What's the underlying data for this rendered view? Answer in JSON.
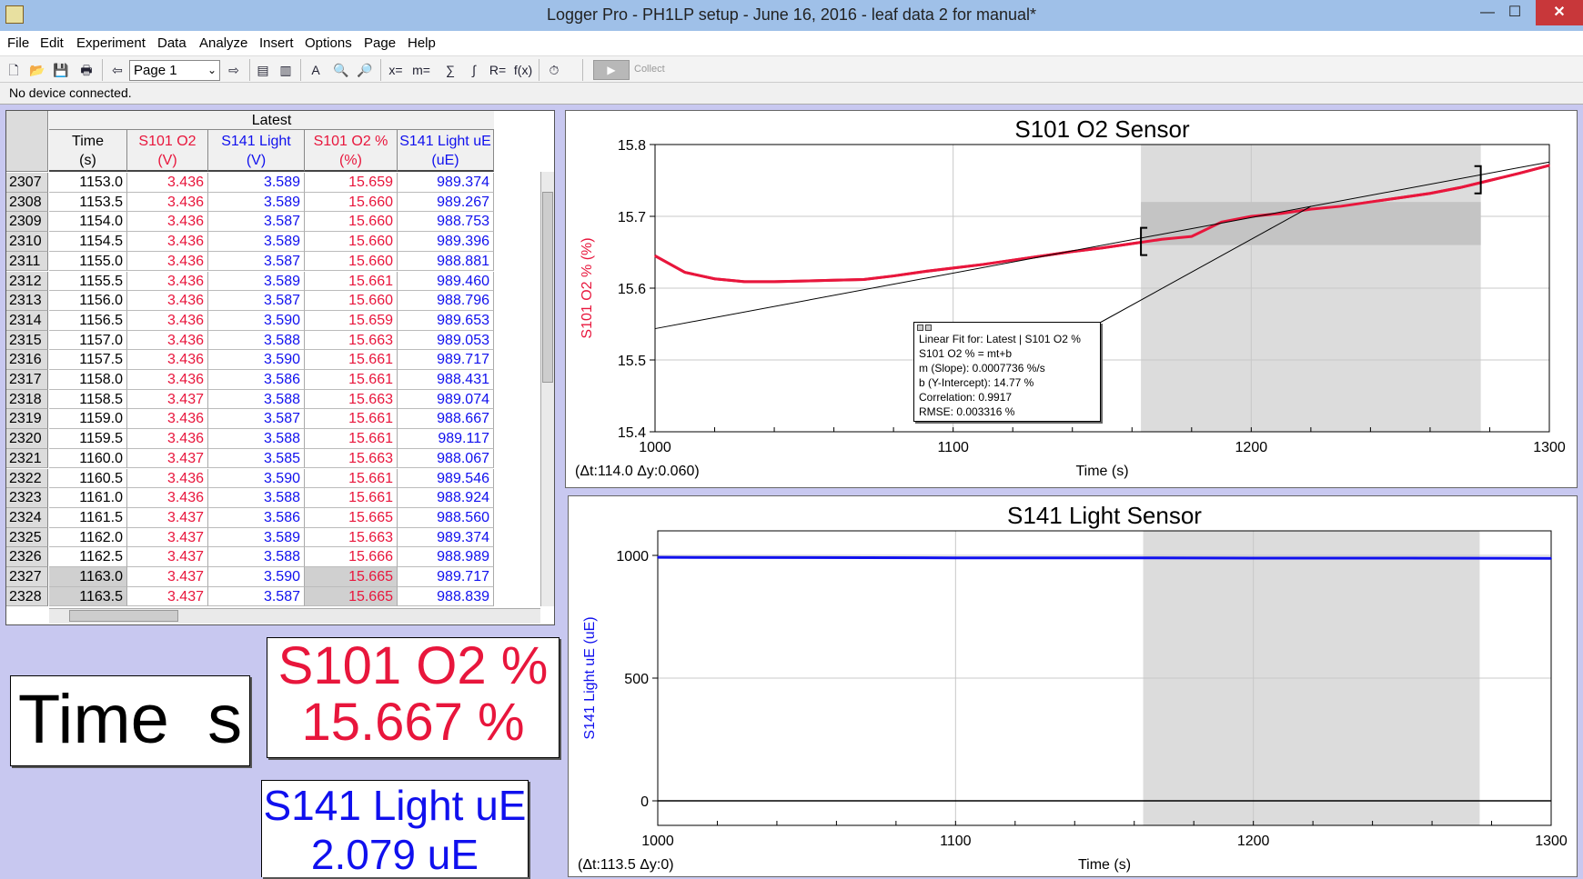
{
  "window": {
    "title": "Logger Pro - PH1LP setup  - June 16, 2016 - leaf data 2 for manual*",
    "minimize": "—",
    "maximize": "☐",
    "close": "✕"
  },
  "menu": [
    "File",
    "Edit",
    "Experiment",
    "Data",
    "Analyze",
    "Insert",
    "Options",
    "Page",
    "Help"
  ],
  "toolbar": {
    "page_select": "Page 1",
    "collect_label": "Collect",
    "icons": [
      "new-file-icon",
      "open-folder-icon",
      "save-icon",
      "print-icon",
      "page-back-icon",
      "page-forward-icon",
      "data-browser-icon",
      "lab-book-icon",
      "autoscale-icon",
      "zoom-in-icon",
      "zoom-out-icon",
      "examine-icon",
      "tangent-icon",
      "statistics-icon",
      "integral-icon",
      "linear-fit-icon",
      "curve-fit-icon",
      "replay-icon",
      "collect-icon"
    ]
  },
  "status": "No device connected.",
  "table": {
    "group": "Latest",
    "columns": [
      {
        "name": "Time",
        "unit": "(s)",
        "color": "#000000"
      },
      {
        "name": "S101 O2",
        "unit": "(V)",
        "color": "#e8163c"
      },
      {
        "name": "S141 Light",
        "unit": "(V)",
        "color": "#1010ee"
      },
      {
        "name": "S101 O2 %",
        "unit": "(%)",
        "color": "#e8163c"
      },
      {
        "name": "S141 Light uE",
        "unit": "(uE)",
        "color": "#1010ee"
      }
    ],
    "rows": [
      [
        "2307",
        "1153.0",
        "3.436",
        "3.589",
        "15.659",
        "989.374"
      ],
      [
        "2308",
        "1153.5",
        "3.436",
        "3.589",
        "15.660",
        "989.267"
      ],
      [
        "2309",
        "1154.0",
        "3.436",
        "3.587",
        "15.660",
        "988.753"
      ],
      [
        "2310",
        "1154.5",
        "3.436",
        "3.589",
        "15.660",
        "989.396"
      ],
      [
        "2311",
        "1155.0",
        "3.436",
        "3.587",
        "15.660",
        "988.881"
      ],
      [
        "2312",
        "1155.5",
        "3.436",
        "3.589",
        "15.661",
        "989.460"
      ],
      [
        "2313",
        "1156.0",
        "3.436",
        "3.587",
        "15.660",
        "988.796"
      ],
      [
        "2314",
        "1156.5",
        "3.436",
        "3.590",
        "15.659",
        "989.653"
      ],
      [
        "2315",
        "1157.0",
        "3.436",
        "3.588",
        "15.663",
        "989.053"
      ],
      [
        "2316",
        "1157.5",
        "3.436",
        "3.590",
        "15.661",
        "989.717"
      ],
      [
        "2317",
        "1158.0",
        "3.436",
        "3.586",
        "15.661",
        "988.431"
      ],
      [
        "2318",
        "1158.5",
        "3.437",
        "3.588",
        "15.663",
        "989.074"
      ],
      [
        "2319",
        "1159.0",
        "3.436",
        "3.587",
        "15.661",
        "988.667"
      ],
      [
        "2320",
        "1159.5",
        "3.436",
        "3.588",
        "15.661",
        "989.117"
      ],
      [
        "2321",
        "1160.0",
        "3.437",
        "3.585",
        "15.663",
        "988.067"
      ],
      [
        "2322",
        "1160.5",
        "3.436",
        "3.590",
        "15.661",
        "989.546"
      ],
      [
        "2323",
        "1161.0",
        "3.436",
        "3.588",
        "15.661",
        "988.924"
      ],
      [
        "2324",
        "1161.5",
        "3.437",
        "3.586",
        "15.665",
        "988.560"
      ],
      [
        "2325",
        "1162.0",
        "3.437",
        "3.589",
        "15.663",
        "989.374"
      ],
      [
        "2326",
        "1162.5",
        "3.437",
        "3.588",
        "15.666",
        "988.989"
      ],
      [
        "2327",
        "1163.0",
        "3.437",
        "3.590",
        "15.665",
        "989.717"
      ],
      [
        "2328",
        "1163.5",
        "3.437",
        "3.587",
        "15.665",
        "988.839"
      ]
    ]
  },
  "meters": {
    "time": {
      "label": "Time",
      "unit": "s"
    },
    "o2": {
      "label": "S101 O2 %",
      "value": "15.667 %"
    },
    "light": {
      "label": "S141 Light uE",
      "value": "2.079 uE"
    }
  },
  "graph_o2": {
    "title": "S101 O2 Sensor",
    "xlabel": "Time (s)",
    "ylabel": "S101 O2 % (%)",
    "delta": "(Δt:114.0 Δy:0.060)",
    "fit_box": {
      "title": "Linear Fit for: Latest | S101 O2 %",
      "equation": "S101 O2 % = mt+b",
      "slope": "m (Slope): 0.0007736 %/s",
      "intercept": "b (Y-Intercept): 14.77 %",
      "correlation": "Correlation: 0.9917",
      "rmse": "RMSE: 0.003316 %"
    },
    "x_ticks": [
      "1000",
      "1100",
      "1200",
      "1300"
    ],
    "y_ticks": [
      "15.8",
      "15.7",
      "15.6",
      "15.5",
      "15.4"
    ]
  },
  "graph_light": {
    "title": "S141 Light Sensor",
    "xlabel": "Time (s)",
    "ylabel": "S141 Light uE (uE)",
    "delta": "(Δt:113.5 Δy:0)",
    "x_ticks": [
      "1000",
      "1100",
      "1200",
      "1300"
    ],
    "y_ticks": [
      "1000",
      "500",
      "0"
    ]
  },
  "chart_data": [
    {
      "type": "line",
      "title": "S101 O2 Sensor",
      "xlabel": "Time (s)",
      "ylabel": "S101 O2 % (%)",
      "xlim": [
        1000,
        1300
      ],
      "ylim": [
        15.4,
        15.8
      ],
      "grid": true,
      "selection": [
        1163,
        1277
      ],
      "series": [
        {
          "name": "S101 O2 %",
          "color": "#e8163c",
          "x": [
            1000,
            1010,
            1020,
            1030,
            1040,
            1050,
            1060,
            1070,
            1080,
            1090,
            1100,
            1110,
            1120,
            1130,
            1140,
            1150,
            1160,
            1170,
            1180,
            1190,
            1200,
            1210,
            1220,
            1230,
            1240,
            1250,
            1260,
            1270,
            1280,
            1290,
            1300
          ],
          "y": [
            15.645,
            15.622,
            15.613,
            15.609,
            15.609,
            15.61,
            15.611,
            15.612,
            15.617,
            15.623,
            15.628,
            15.633,
            15.639,
            15.645,
            15.651,
            15.656,
            15.662,
            15.668,
            15.672,
            15.692,
            15.7,
            15.704,
            15.71,
            15.714,
            15.72,
            15.726,
            15.732,
            15.74,
            15.75,
            15.76,
            15.771
          ]
        }
      ],
      "fit_line": {
        "slope": 0.0007736,
        "intercept": 14.77
      }
    },
    {
      "type": "line",
      "title": "S141 Light Sensor",
      "xlabel": "Time (s)",
      "ylabel": "S141 Light uE (uE)",
      "xlim": [
        1000,
        1300
      ],
      "ylim": [
        -100,
        1100
      ],
      "grid": true,
      "selection": [
        1163,
        1276
      ],
      "series": [
        {
          "name": "S141 Light uE",
          "color": "#1010ee",
          "x": [
            1000,
            1050,
            1100,
            1150,
            1200,
            1250,
            1300
          ],
          "y": [
            992,
            991,
            990,
            990,
            989,
            989,
            988
          ]
        }
      ]
    }
  ]
}
